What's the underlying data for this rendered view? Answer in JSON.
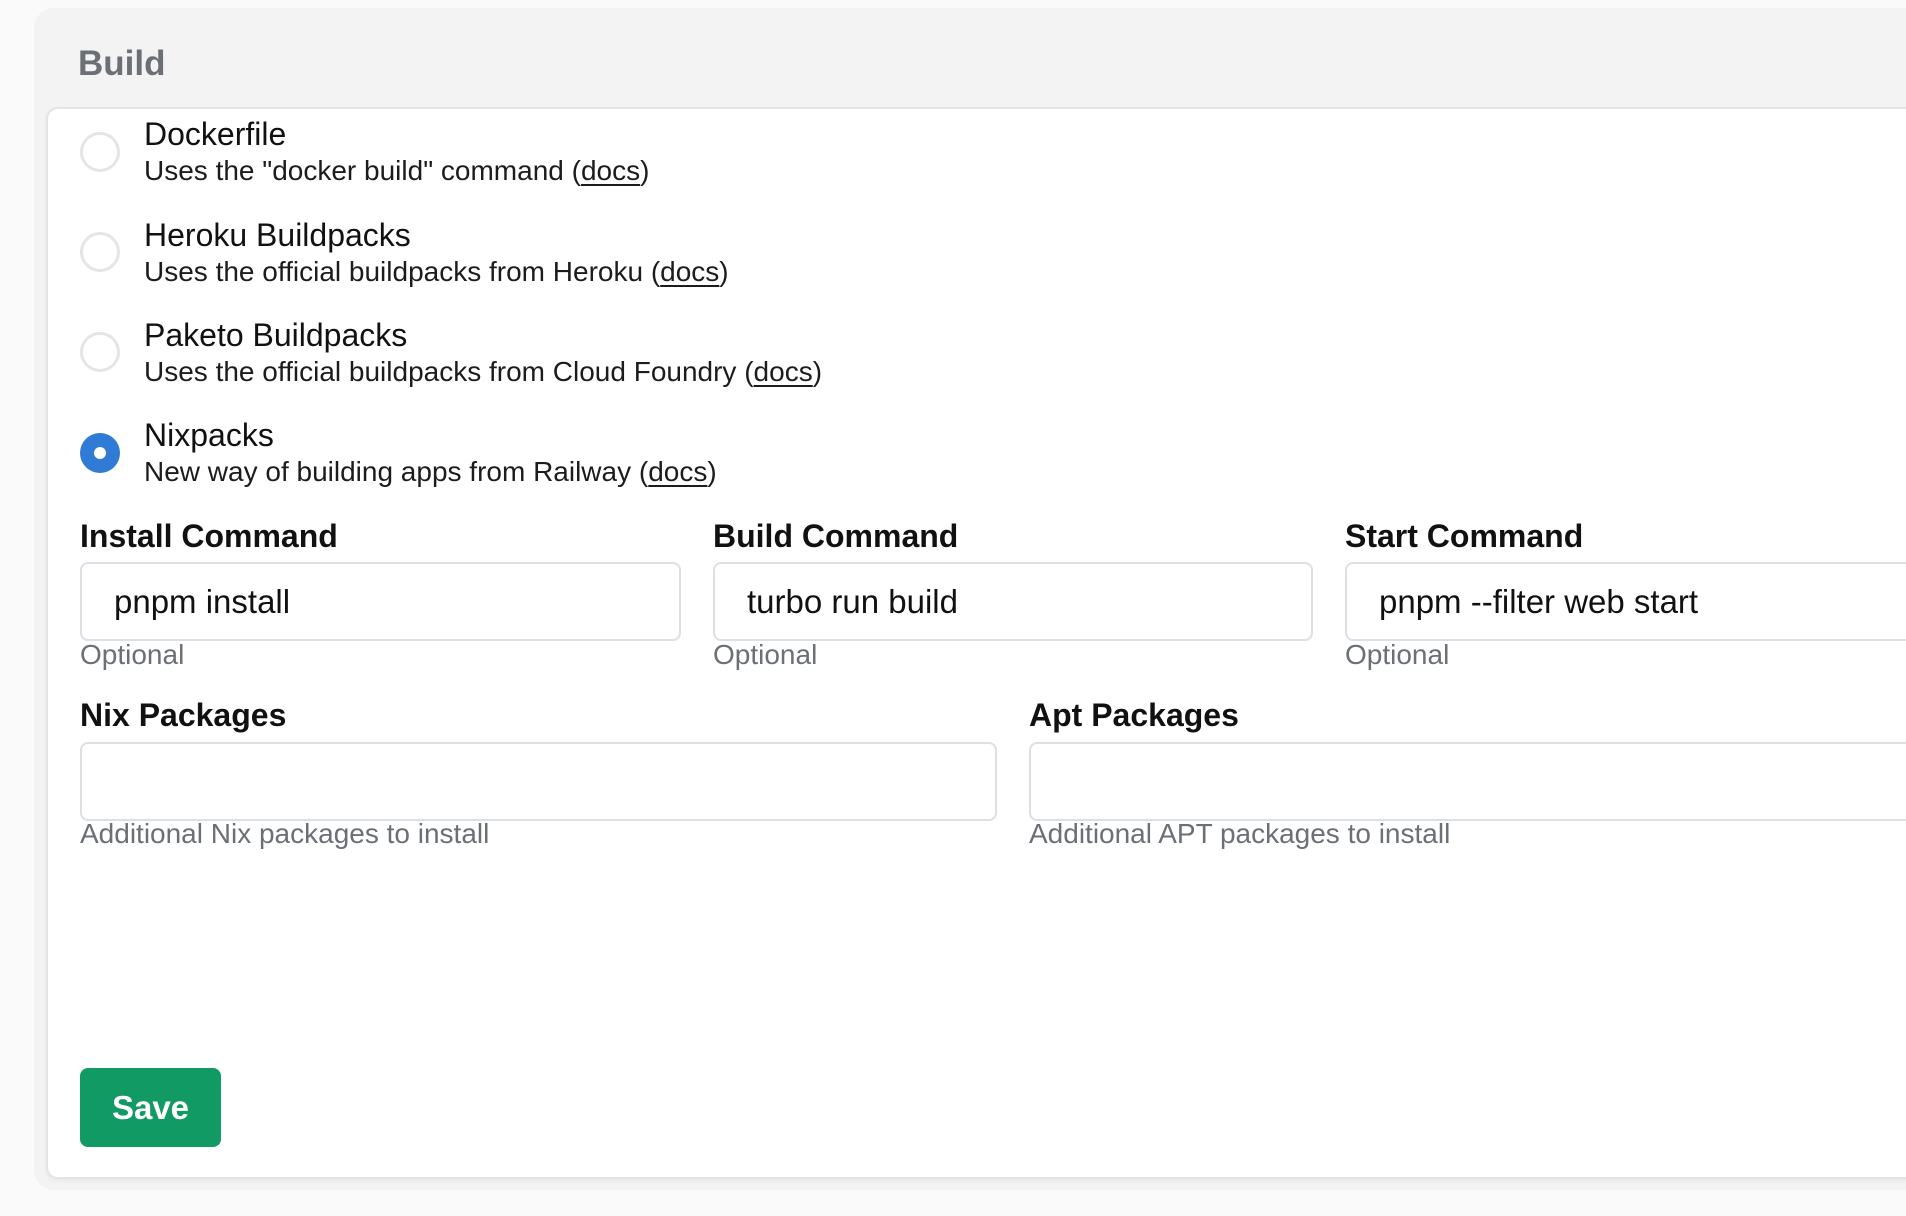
{
  "section": {
    "title": "Build"
  },
  "builders": [
    {
      "title": "Dockerfile",
      "desc_prefix": "Uses the \"docker build\" command (",
      "link": "docs",
      "desc_suffix": ")",
      "selected": false
    },
    {
      "title": "Heroku Buildpacks",
      "desc_prefix": "Uses the official buildpacks from Heroku (",
      "link": "docs",
      "desc_suffix": ")",
      "selected": false
    },
    {
      "title": "Paketo Buildpacks",
      "desc_prefix": "Uses the official buildpacks from Cloud Foundry (",
      "link": "docs",
      "desc_suffix": ")",
      "selected": false
    },
    {
      "title": "Nixpacks",
      "desc_prefix": "New way of building apps from Railway (",
      "link": "docs",
      "desc_suffix": ")",
      "selected": true
    }
  ],
  "fields": {
    "install": {
      "label": "Install Command",
      "value": "pnpm install",
      "help": "Optional"
    },
    "build": {
      "label": "Build Command",
      "value": "turbo run build",
      "help": "Optional"
    },
    "start": {
      "label": "Start Command",
      "value": "pnpm --filter web start",
      "help": "Optional"
    },
    "nix": {
      "label": "Nix Packages",
      "value": "",
      "help": "Additional Nix packages to install"
    },
    "apt": {
      "label": "Apt Packages",
      "value": "",
      "help": "Additional APT packages to install"
    }
  },
  "actions": {
    "save_label": "Save"
  },
  "colors": {
    "accent": "#2f7bd6",
    "save_button": "#119a63",
    "muted_text": "#6b6f76"
  }
}
